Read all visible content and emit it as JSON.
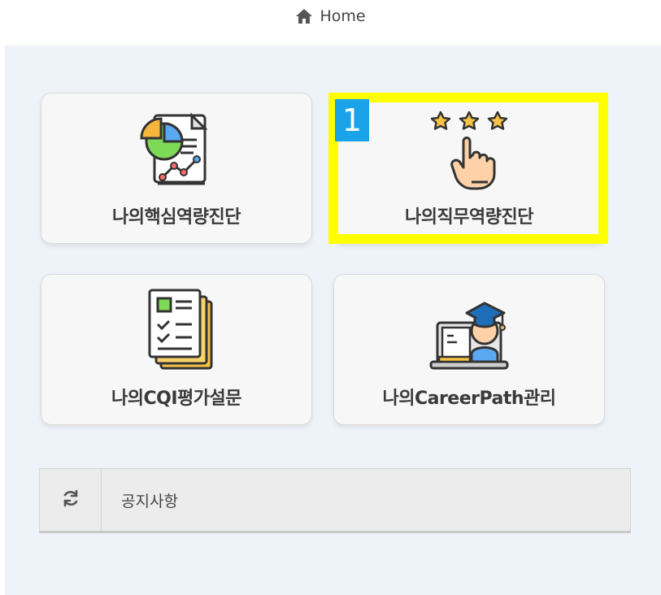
{
  "header": {
    "home_label": "Home",
    "home_icon": "home-icon"
  },
  "menu": {
    "items": [
      {
        "label": "나의핵심역량진단",
        "icon": "chart-report-icon"
      },
      {
        "label": "나의직무역량진단",
        "icon": "star-hand-icon"
      },
      {
        "label": "나의CQI평가설문",
        "icon": "checklist-icon"
      },
      {
        "label": "나의CareerPath관리",
        "icon": "graduate-laptop-icon"
      }
    ]
  },
  "annotation": {
    "marker_number": "1",
    "highlight_color": "#ffff00",
    "marker_color": "#1aa3e8"
  },
  "notice": {
    "refresh_icon": "refresh-icon",
    "title": "공지사항"
  }
}
